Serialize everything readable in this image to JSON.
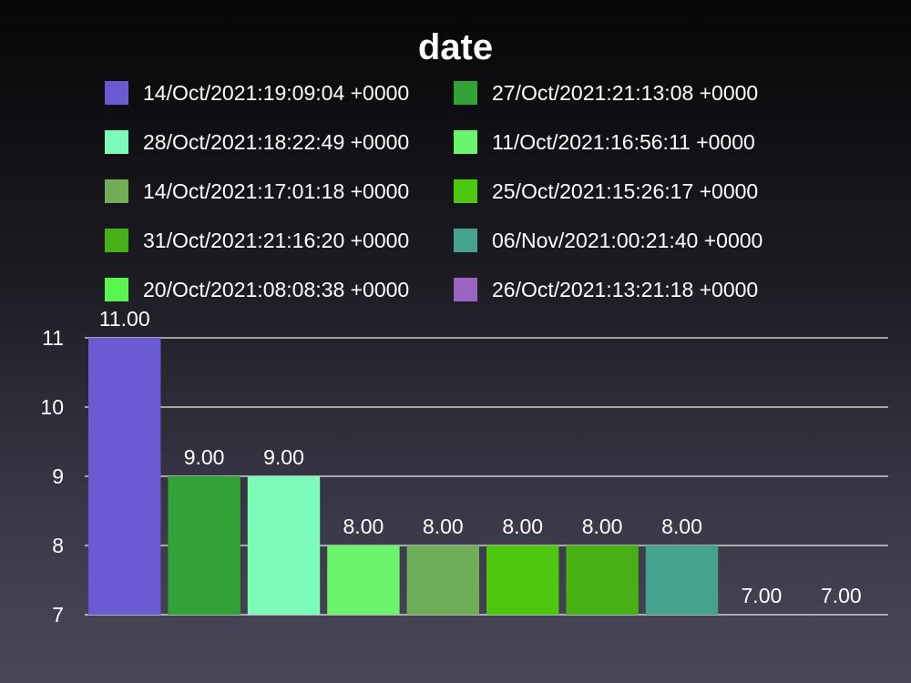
{
  "chart_data": {
    "type": "bar",
    "title": "date",
    "xlabel": "",
    "ylabel": "",
    "ylim": [
      7,
      11
    ],
    "yticks": [
      "7",
      "8",
      "9",
      "10",
      "11"
    ],
    "grid": true,
    "legend_position": "top",
    "categories": [
      "14/Oct/2021:19:09:04 +0000",
      "27/Oct/2021:21:13:08 +0000",
      "28/Oct/2021:18:22:49 +0000",
      "11/Oct/2021:16:56:11 +0000",
      "14/Oct/2021:17:01:18 +0000",
      "25/Oct/2021:15:26:17 +0000",
      "31/Oct/2021:21:16:20 +0000",
      "06/Nov/2021:00:21:40 +0000",
      "20/Oct/2021:08:08:38 +0000",
      "26/Oct/2021:13:21:18 +0000"
    ],
    "values": [
      11,
      9,
      9,
      8,
      8,
      8,
      8,
      8,
      7,
      7
    ],
    "value_labels": [
      "11.00",
      "9.00",
      "9.00",
      "8.00",
      "8.00",
      "8.00",
      "8.00",
      "8.00",
      "7.00",
      "7.00"
    ],
    "colors": [
      "#6b5bd2",
      "#31a337",
      "#7dfcb9",
      "#6af56c",
      "#70ad57",
      "#4dc80f",
      "#46b014",
      "#45a38d",
      "#57f54e",
      "#9a64c3"
    ]
  }
}
